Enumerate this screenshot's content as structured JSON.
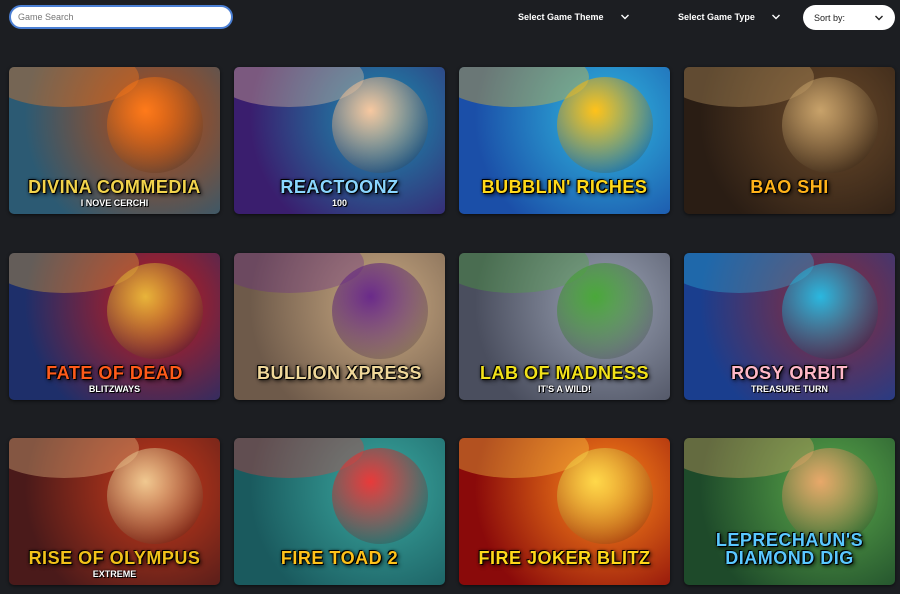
{
  "search": {
    "placeholder": "Game Search"
  },
  "filters": {
    "theme_label": "Select Game Theme",
    "type_label": "Select Game Type",
    "sort_label": "Sort by:"
  },
  "games": [
    {
      "title": "Divina Commedia",
      "sub": "I Nove Cerchi",
      "bg1": "#2c5a73",
      "bg2": "#b84a12",
      "accent": "#ff7a1a",
      "text_color": "#f2d34c"
    },
    {
      "title": "Reactoonz",
      "sub": "100",
      "bg1": "#3a1e6e",
      "bg2": "#1a8fb0",
      "accent": "#f7c8a0",
      "text_color": "#8ad6ff"
    },
    {
      "title": "Bubblin' Riches",
      "sub": "",
      "bg1": "#1b4fa8",
      "bg2": "#2fb8e0",
      "accent": "#ffc21a",
      "text_color": "#ffd91a"
    },
    {
      "title": "Bao Shi",
      "sub": "",
      "bg1": "#2a1d14",
      "bg2": "#6b4a2a",
      "accent": "#c8a26a",
      "text_color": "#ffb21a"
    },
    {
      "title": "Fate of Dead",
      "sub": "Blitzways",
      "bg1": "#1e2f6a",
      "bg2": "#c41a1a",
      "accent": "#e8b43a",
      "text_color": "#ff5a1a"
    },
    {
      "title": "Bullion Xpress",
      "sub": "",
      "bg1": "#6e5a4a",
      "bg2": "#c9a982",
      "accent": "#6a2a8a",
      "text_color": "#f0d89a"
    },
    {
      "title": "Lab of Madness",
      "sub": "It's a Wild!",
      "bg1": "#4a4e5e",
      "bg2": "#9aa2b4",
      "accent": "#4aa83a",
      "text_color": "#f2e21a"
    },
    {
      "title": "Rosy Orbit",
      "sub": "Treasure Turn",
      "bg1": "#1a3e8e",
      "bg2": "#8a2a3a",
      "accent": "#2ab8e0",
      "text_color": "#ffb8c8"
    },
    {
      "title": "Rise of Olympus",
      "sub": "Extreme",
      "bg1": "#4a1a1a",
      "bg2": "#c83a1a",
      "accent": "#f0c890",
      "text_color": "#f2c21a"
    },
    {
      "title": "Fire Toad 2",
      "sub": "",
      "bg1": "#1a5a5e",
      "bg2": "#3aa8a0",
      "accent": "#e83a3a",
      "text_color": "#ffc21a"
    },
    {
      "title": "Fire Joker Blitz",
      "sub": "",
      "bg1": "#8a0a0a",
      "bg2": "#ff8a1a",
      "accent": "#ffd84a",
      "text_color": "#ffd81a"
    },
    {
      "title": "Leprechaun's Diamond Dig",
      "sub": "",
      "bg1": "#1e4a2a",
      "bg2": "#5aa84a",
      "accent": "#e8a86a",
      "text_color": "#5ac8ff"
    }
  ]
}
